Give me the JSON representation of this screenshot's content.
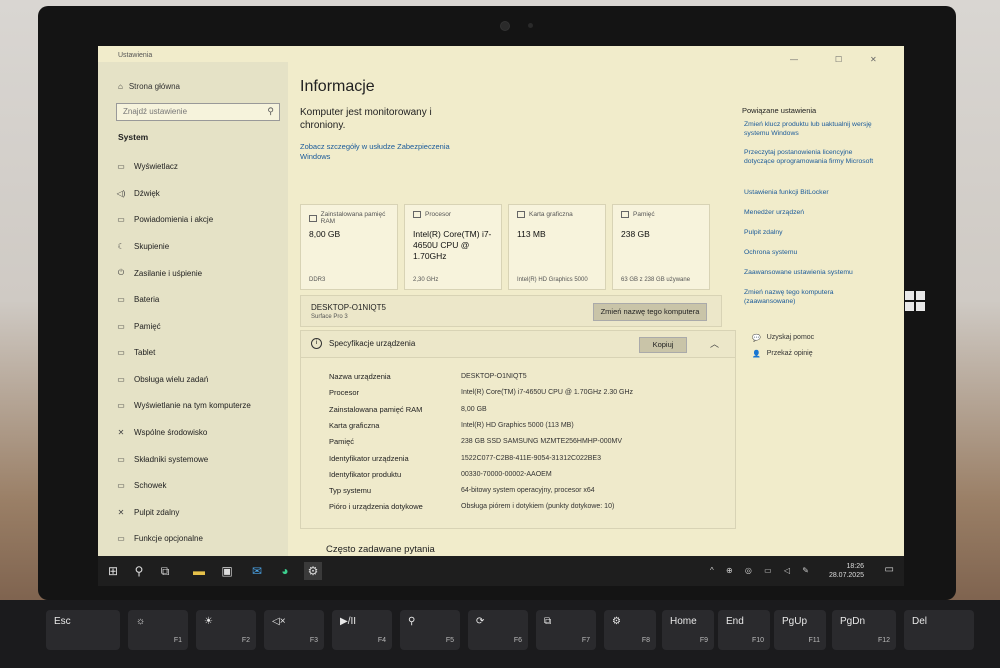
{
  "window": {
    "title": "Ustawienia",
    "min": "—",
    "max": "☐",
    "close": "✕"
  },
  "sidebar": {
    "home": "Strona główna",
    "search_placeholder": "Znajdź ustawienie",
    "section": "System",
    "items": [
      {
        "label": "Wyświetlacz",
        "icon": "▭"
      },
      {
        "label": "Dźwięk",
        "icon": "◁)"
      },
      {
        "label": "Powiadomienia i akcje",
        "icon": "▭"
      },
      {
        "label": "Skupienie",
        "icon": "☾"
      },
      {
        "label": "Zasilanie i uśpienie",
        "icon": "⏻"
      },
      {
        "label": "Bateria",
        "icon": "▭"
      },
      {
        "label": "Pamięć",
        "icon": "▭"
      },
      {
        "label": "Tablet",
        "icon": "▭"
      },
      {
        "label": "Obsługa wielu zadań",
        "icon": "▭"
      },
      {
        "label": "Wyświetlanie na tym komputerze",
        "icon": "▭"
      },
      {
        "label": "Wspólne środowisko",
        "icon": "✕"
      },
      {
        "label": "Składniki systemowe",
        "icon": "▭"
      },
      {
        "label": "Schowek",
        "icon": "▭"
      },
      {
        "label": "Pulpit zdalny",
        "icon": "✕"
      },
      {
        "label": "Funkcje opcjonalne",
        "icon": "▭"
      }
    ]
  },
  "main": {
    "title": "Informacje",
    "protect_text": "Komputer jest monitorowany i chroniony.",
    "security_link": "Zobacz szczegóły w usłudze Zabezpieczenia Windows",
    "cards": [
      {
        "label": "Zainstalowana pamięć RAM",
        "value": "8,00 GB",
        "sub": "DDR3"
      },
      {
        "label": "Procesor",
        "value": "Intel(R) Core(TM) i7-4650U CPU @ 1.70GHz",
        "sub": "2,30 GHz"
      },
      {
        "label": "Karta graficzna",
        "value": "113 MB",
        "sub": "Intel(R) HD Graphics 5000"
      },
      {
        "label": "Pamięć",
        "value": "238 GB",
        "sub": "63 GB z 238 GB używane"
      }
    ],
    "device_name": "DESKTOP-O1NIQT5",
    "device_model": "Surface Pro 3",
    "rename_button": "Zmień nazwę tego komputera",
    "spec_title": "Specyfikacje urządzenia",
    "copy_button": "Kopiuj",
    "specs": [
      {
        "key": "Nazwa urządzenia",
        "value": "DESKTOP-O1NIQT5"
      },
      {
        "key": "Procesor",
        "value": "Intel(R) Core(TM) i7-4650U CPU @ 1.70GHz   2.30 GHz"
      },
      {
        "key": "Zainstalowana pamięć RAM",
        "value": "8,00 GB"
      },
      {
        "key": "Karta graficzna",
        "value": "Intel(R) HD Graphics 5000 (113 MB)"
      },
      {
        "key": "Pamięć",
        "value": "238 GB SSD SAMSUNG MZMTE256HMHP-000MV"
      },
      {
        "key": "Identyfikator urządzenia",
        "value": "1522C077-C2B8-411E-9054-31312C022BE3"
      },
      {
        "key": "Identyfikator produktu",
        "value": "00330-70000-00002-AAOEM"
      },
      {
        "key": "Typ systemu",
        "value": "64-bitowy system operacyjny, procesor x64"
      },
      {
        "key": "Pióro i urządzenia dotykowe",
        "value": "Obsługa piórem i dotykiem (punkty dotykowe: 10)"
      }
    ],
    "faq": "Często zadawane pytania"
  },
  "related": {
    "title": "Powiązane ustawienia",
    "links": [
      "Zmień klucz produktu lub uaktualnij wersję systemu Windows",
      "Przeczytaj postanowienia licencyjne dotyczące oprogramowania firmy Microsoft",
      "Ustawienia funkcji BitLocker",
      "Menedżer urządzeń",
      "Pulpit zdalny",
      "Ochrona systemu",
      "Zaawansowane ustawienia systemu",
      "Zmień nazwę tego komputera (zaawansowane)"
    ],
    "help": "Uzyskaj pomoc",
    "feedback": "Przekaż opinię"
  },
  "taskbar": {
    "time": "18:26",
    "date": "28.07.2025",
    "tray": "^ ⊕ ◎ ▭ ◁ ✎"
  },
  "keyboard": [
    {
      "label": "Esc",
      "fn": ""
    },
    {
      "label": "☼",
      "fn": "F1"
    },
    {
      "label": "☀",
      "fn": "F2"
    },
    {
      "label": "◁×",
      "fn": "F3"
    },
    {
      "label": "▶/II",
      "fn": "F4"
    },
    {
      "label": "⚲",
      "fn": "F5"
    },
    {
      "label": "⟳",
      "fn": "F6"
    },
    {
      "label": "⧉",
      "fn": "F7"
    },
    {
      "label": "⚙",
      "fn": "F8"
    },
    {
      "label": "Home",
      "fn": "F9"
    },
    {
      "label": "End",
      "fn": "F10"
    },
    {
      "label": "PgUp",
      "fn": "F11"
    },
    {
      "label": "PgDn",
      "fn": "F12"
    },
    {
      "label": "Del",
      "fn": ""
    }
  ]
}
